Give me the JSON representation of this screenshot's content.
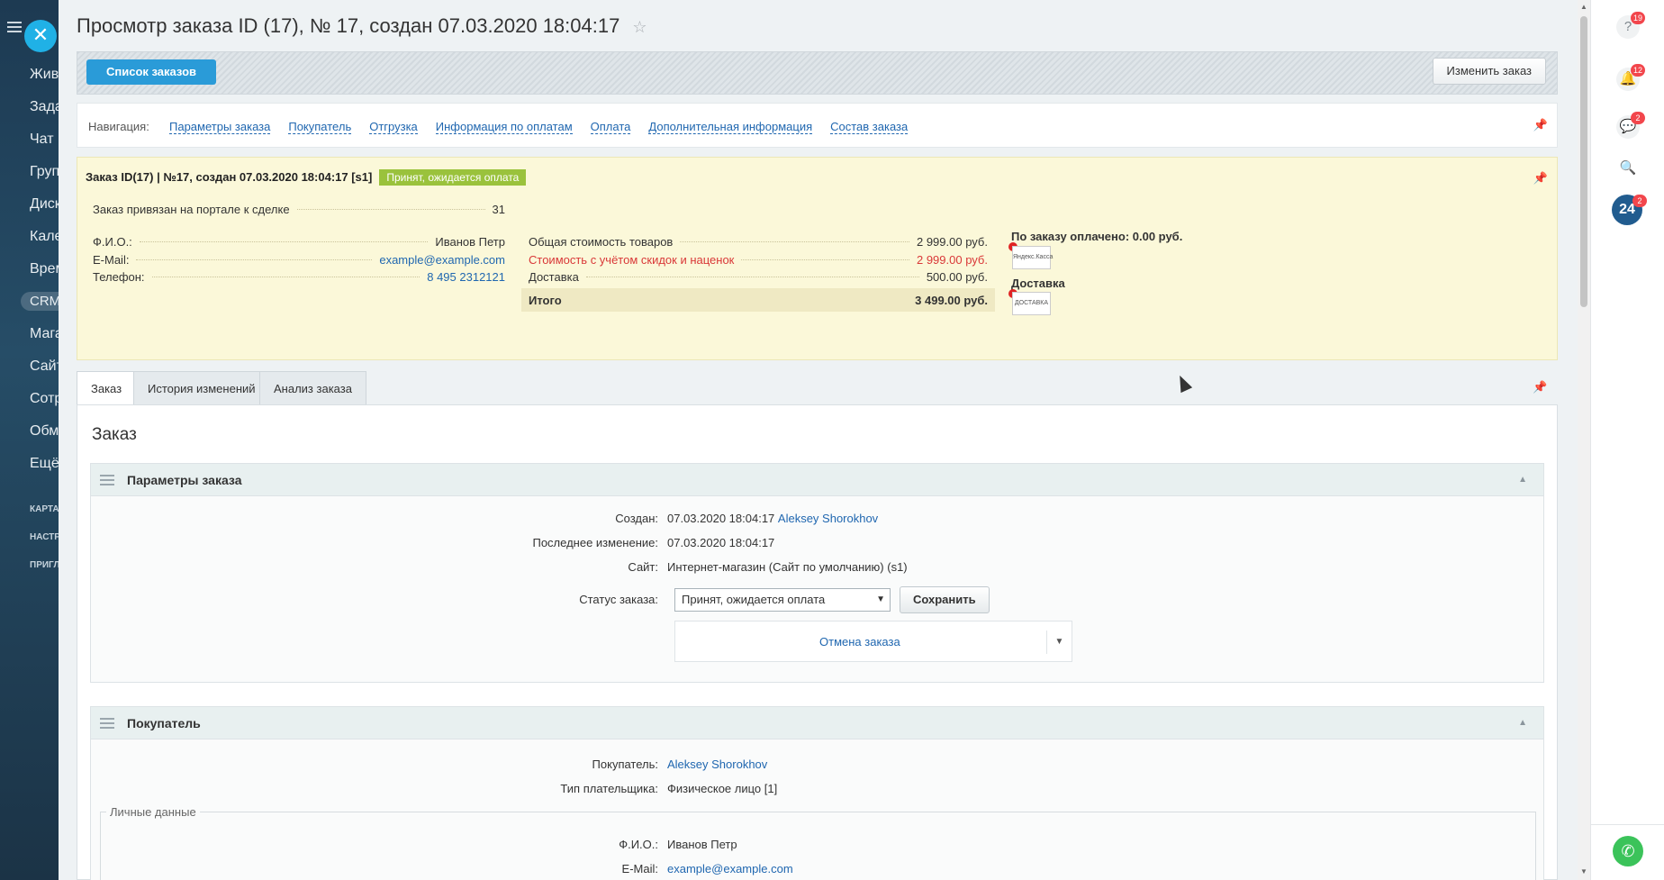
{
  "leftbar": {
    "items": [
      "Жив",
      "Зада",
      "Чат",
      "Груп",
      "Диск",
      "Кале",
      "Врем",
      "CRM",
      "Мага",
      "Сайт",
      "Сотр",
      "Обм",
      "Ещё"
    ],
    "small": [
      "КАРТА",
      "НАСТР",
      "ПРИГЛ"
    ],
    "close_glyph": "✕"
  },
  "page": {
    "title": "Просмотр заказа ID (17), № 17, создан 07.03.2020 18:04:17",
    "star_icon": "☆"
  },
  "toolbar": {
    "list_label": "Список заказов",
    "edit_label": "Изменить заказ"
  },
  "nav": {
    "label": "Навигация:",
    "links": [
      "Параметры заказа",
      "Покупатель",
      "Отгрузка",
      "Информация по оплатам",
      "Оплата",
      "Дополнительная информация",
      "Состав заказа"
    ]
  },
  "summary": {
    "header": "Заказ ID(17) | №17, создан 07.03.2020 18:04:17 [s1]",
    "status_badge": "Принят, ожидается оплата",
    "deal_label": "Заказ привязан на портале к сделке",
    "deal_value": "31",
    "fio_label": "Ф.И.О.:",
    "fio_value": "Иванов Петр",
    "email_label": "E-Mail:",
    "email_value": "example@example.com",
    "phone_label": "Телефон:",
    "phone_value": "8 495 2312121",
    "goods_label": "Общая стоимость товаров",
    "goods_value": "2 999.00 руб.",
    "discount_label": "Стоимость с учётом скидок и наценок",
    "discount_value": "2 999.00 руб.",
    "delivery_label": "Доставка",
    "delivery_value": "500.00 руб.",
    "total_label": "Итого",
    "total_value": "3 499.00 руб.",
    "paid_text": "По заказу оплачено: 0.00 руб.",
    "pay_logo_text": "Яндекс.Касса",
    "delivery_title": "Доставка",
    "delivery_logo_text": "ДОСТАВКА"
  },
  "tabs": [
    "Заказ",
    "История изменений",
    "Анализ заказа"
  ],
  "content": {
    "heading": "Заказ",
    "params": {
      "title": "Параметры заказа",
      "created_label": "Создан:",
      "created_value": "07.03.2020 18:04:17",
      "created_user": "Aleksey Shorokhov",
      "modified_label": "Последнее изменение:",
      "modified_value": "07.03.2020 18:04:17",
      "site_label": "Сайт:",
      "site_value": "Интернет-магазин (Сайт по умолчанию) (s1)",
      "status_label": "Статус заказа:",
      "status_value": "Принят, ожидается оплата",
      "save_label": "Сохранить",
      "cancel_label": "Отмена заказа"
    },
    "buyer": {
      "title": "Покупатель",
      "buyer_label": "Покупатель:",
      "buyer_value": "Aleksey Shorokhov",
      "payer_label": "Тип плательщика:",
      "payer_value": "Физическое лицо [1]",
      "personal_legend": "Личные данные",
      "fio_label": "Ф.И.О.:",
      "fio_value": "Иванов Петр",
      "email_label": "E-Mail:",
      "email_value": "example@example.com"
    }
  },
  "rail": {
    "help_badge": "19",
    "bell_badge": "12",
    "chat_badge": "2",
    "b24_label": "24",
    "b24_badge": "2"
  },
  "colors": {
    "accent": "#2a9bd8",
    "status_badge": "#9ac23c",
    "summary_bg": "#fbf8d9",
    "link": "#2067b0"
  }
}
